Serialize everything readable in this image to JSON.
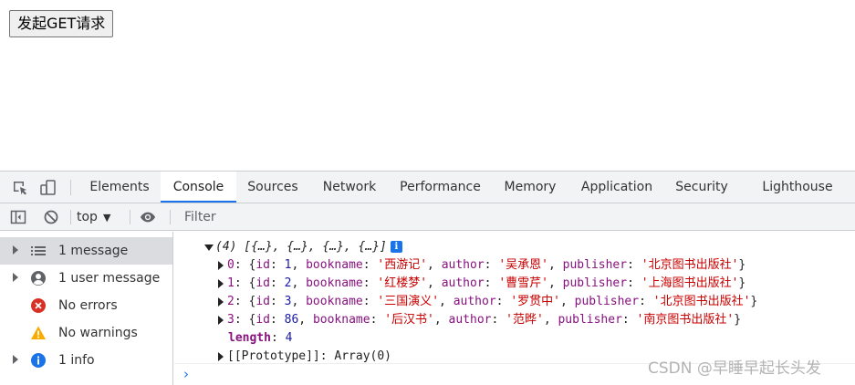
{
  "page": {
    "button_label": "发起GET请求"
  },
  "devtools": {
    "tabs": [
      {
        "label": "Elements",
        "active": false
      },
      {
        "label": "Console",
        "active": true
      },
      {
        "label": "Sources",
        "active": false
      },
      {
        "label": "Network",
        "active": false
      },
      {
        "label": "Performance",
        "active": false
      },
      {
        "label": "Memory",
        "active": false
      },
      {
        "label": "Application",
        "active": false
      },
      {
        "label": "Security",
        "active": false
      },
      {
        "label": "Lighthouse",
        "active": false
      }
    ],
    "toolbar": {
      "context": "top",
      "filter_placeholder": "Filter"
    },
    "sidebar": {
      "items": [
        {
          "label": "1 message",
          "icon": "list-icon",
          "selected": true,
          "expandable": true
        },
        {
          "label": "1 user message",
          "icon": "user-icon",
          "selected": false,
          "expandable": true
        },
        {
          "label": "No errors",
          "icon": "error-icon",
          "selected": false,
          "expandable": false
        },
        {
          "label": "No warnings",
          "icon": "warning-icon",
          "selected": false,
          "expandable": false
        },
        {
          "label": "1 info",
          "icon": "info-icon",
          "selected": false,
          "expandable": true
        }
      ]
    },
    "console": {
      "summary": "(4) [{…}, {…}, {…}, {…}]",
      "rows": [
        {
          "index": "0",
          "id": "1",
          "bookname": "'西游记'",
          "author": "'吴承恩'",
          "publisher": "'北京图书出版社'"
        },
        {
          "index": "1",
          "id": "2",
          "bookname": "'红楼梦'",
          "author": "'曹雪芹'",
          "publisher": "'上海图书出版社'"
        },
        {
          "index": "2",
          "id": "3",
          "bookname": "'三国演义'",
          "author": "'罗贯中'",
          "publisher": "'北京图书出版社'"
        },
        {
          "index": "3",
          "id": "86",
          "bookname": "'后汉书'",
          "author": "'范晔'",
          "publisher": "'南京图书出版社'"
        }
      ],
      "length_key": "length",
      "length_value": "4",
      "prototype": "[[Prototype]]: Array(0)"
    }
  },
  "watermark": "CSDN @早睡早起长头发",
  "colors": {
    "accent": "#1a73e8",
    "string": "#c80000",
    "key": "#881280",
    "number": "#1a1aa6",
    "error": "#d93025",
    "warning": "#f9ab00"
  }
}
